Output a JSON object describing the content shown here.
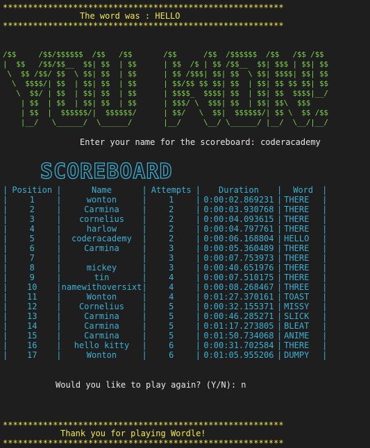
{
  "stars": "********************************************************",
  "word_reveal": "The word was : HELLO",
  "ascii_banner": [
    "/$$     /$$/$$$$$$  /$$   /$$       /$$      /$$  /$$$$$$  /$$   /$$ /$$",
    "|  $$   /$$/$$__  $$| $$  | $$      | $$  /$ | $$ /$$__  $$| $$$ | $$| $$",
    " \\  $$ /$$/ $$  \\ $$| $$  | $$      | $$ /$$$| $$| $$  \\ $$| $$$$| $$| $$",
    "  \\  $$$$/| $$  | $$| $$  | $$      | $$/$$ $$ $$| $$  | $$| $$ $$ $$| $$",
    "   \\  $$/ | $$  | $$| $$  | $$      | $$$$_  $$$$| $$  | $$| $$  $$$$|__/",
    "    | $$  | $$  | $$| $$  | $$      | $$$/ \\  $$$| $$  | $$| $$\\  $$$",
    "    | $$  |  $$$$$$/|  $$$$$$/      | $$/   \\  $$|  $$$$$$/| $$ \\  $$ /$$",
    "    |__/   \\______/  \\______/       |__/     \\__/ \\______/ |__/  \\__/|__/"
  ],
  "name_prompt": "Enter your name for the scoreboard: coderacademy",
  "scoreboard_logo": "SCOREBOARD",
  "columns": [
    "Position",
    "Name",
    "Attempts",
    "Duration",
    "Word"
  ],
  "rows": [
    {
      "pos": "1",
      "name": "wonton",
      "att": "1",
      "dur": "0:00:02.869231",
      "word": "THERE"
    },
    {
      "pos": "2",
      "name": "Carmina",
      "att": "2",
      "dur": "0:00:03.930768",
      "word": "THERE"
    },
    {
      "pos": "3",
      "name": "cornelius",
      "att": "2",
      "dur": "0:00:04.093615",
      "word": "THERE"
    },
    {
      "pos": "4",
      "name": "harlow",
      "att": "2",
      "dur": "0:00:04.797761",
      "word": "THERE"
    },
    {
      "pos": "5",
      "name": "coderacademy",
      "att": "2",
      "dur": "0:00:06.168804",
      "word": "HELLO"
    },
    {
      "pos": "6",
      "name": "Carmina",
      "att": "3",
      "dur": "0:00:05.360489",
      "word": "THERE"
    },
    {
      "pos": "7",
      "name": "",
      "att": "3",
      "dur": "0:00:07.753973",
      "word": "THERE"
    },
    {
      "pos": "8",
      "name": "mickey",
      "att": "3",
      "dur": "0:00:40.651976",
      "word": "THERE"
    },
    {
      "pos": "9",
      "name": "tin",
      "att": "4",
      "dur": "0:00:07.510175",
      "word": "THERE"
    },
    {
      "pos": "10",
      "name": "namewithoversixt",
      "att": "4",
      "dur": "0:00:08.268467",
      "word": "THREE"
    },
    {
      "pos": "11",
      "name": "Wonton",
      "att": "4",
      "dur": "0:01:27.370161",
      "word": "TOAST"
    },
    {
      "pos": "12",
      "name": "Cornelius",
      "att": "5",
      "dur": "0:00:32.155371",
      "word": "MISSY"
    },
    {
      "pos": "13",
      "name": "Carmina",
      "att": "5",
      "dur": "0:00:46.285271",
      "word": "SLICK"
    },
    {
      "pos": "14",
      "name": "Carmina",
      "att": "5",
      "dur": "0:01:17.273805",
      "word": "BLEAT"
    },
    {
      "pos": "15",
      "name": "Carmina",
      "att": "5",
      "dur": "0:01:50.734068",
      "word": "ANIME"
    },
    {
      "pos": "16",
      "name": "hello kitty",
      "att": "6",
      "dur": "0:00:31.702584",
      "word": "THERE"
    },
    {
      "pos": "17",
      "name": "Wonton",
      "att": "6",
      "dur": "0:01:05.955206",
      "word": "DUMPY"
    }
  ],
  "play_again_prompt": "Would you like to play again? (Y/N): n",
  "thanks": "Thank you for playing Wordle!",
  "colors": {
    "background": "#1e1e1e",
    "yellow": "#f2e84b",
    "green": "#7ccf4c",
    "cyan": "#3bb0d4",
    "text": "#e6e6e6"
  }
}
